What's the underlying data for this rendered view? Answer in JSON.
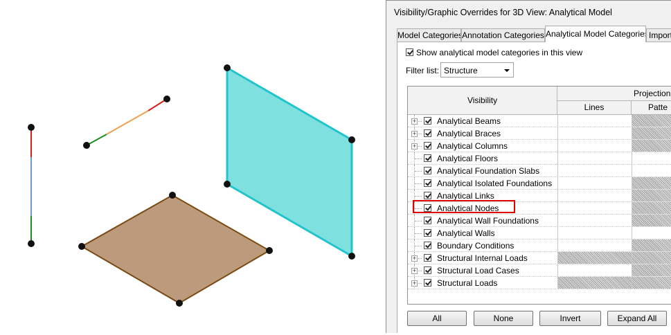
{
  "dialog": {
    "title": "Visibility/Graphic Overrides for 3D View: Analytical Model",
    "tabs": [
      {
        "label": "Model Categories",
        "active": false
      },
      {
        "label": "Annotation Categories",
        "active": false
      },
      {
        "label": "Analytical Model Categories",
        "active": true
      },
      {
        "label": "Import",
        "active": false
      }
    ],
    "show_checkbox": {
      "checked": true,
      "label": "Show analytical model categories in this view"
    },
    "filter": {
      "label": "Filter list:",
      "value": "Structure"
    },
    "table": {
      "header_visibility": "Visibility",
      "header_projection": "Projection",
      "header_lines": "Lines",
      "header_patterns": "Patte",
      "rows": [
        {
          "name": "Analytical Beams",
          "expandable": true,
          "checked": true,
          "lines_hatched": false,
          "patterns_hatched": true
        },
        {
          "name": "Analytical Braces",
          "expandable": true,
          "checked": true,
          "lines_hatched": false,
          "patterns_hatched": true
        },
        {
          "name": "Analytical Columns",
          "expandable": true,
          "checked": true,
          "lines_hatched": false,
          "patterns_hatched": true
        },
        {
          "name": "Analytical Floors",
          "expandable": false,
          "checked": true,
          "lines_hatched": false,
          "patterns_hatched": false
        },
        {
          "name": "Analytical Foundation Slabs",
          "expandable": false,
          "checked": true,
          "lines_hatched": false,
          "patterns_hatched": false
        },
        {
          "name": "Analytical Isolated Foundations",
          "expandable": false,
          "checked": true,
          "lines_hatched": false,
          "patterns_hatched": true
        },
        {
          "name": "Analytical Links",
          "expandable": false,
          "checked": true,
          "lines_hatched": false,
          "patterns_hatched": true
        },
        {
          "name": "Analytical Nodes",
          "expandable": false,
          "checked": true,
          "lines_hatched": false,
          "patterns_hatched": true
        },
        {
          "name": "Analytical Wall Foundations",
          "expandable": false,
          "checked": true,
          "lines_hatched": false,
          "patterns_hatched": true
        },
        {
          "name": "Analytical Walls",
          "expandable": false,
          "checked": true,
          "lines_hatched": false,
          "patterns_hatched": false
        },
        {
          "name": "Boundary Conditions",
          "expandable": false,
          "checked": true,
          "lines_hatched": false,
          "patterns_hatched": true
        },
        {
          "name": "Structural Internal Loads",
          "expandable": true,
          "checked": true,
          "lines_hatched": true,
          "patterns_hatched": true
        },
        {
          "name": "Structural Load Cases",
          "expandable": true,
          "checked": true,
          "lines_hatched": false,
          "patterns_hatched": true
        },
        {
          "name": "Structural Loads",
          "expandable": true,
          "checked": true,
          "lines_hatched": true,
          "patterns_hatched": true
        }
      ],
      "highlighted_row": "Analytical Nodes"
    },
    "buttons": {
      "all": "All",
      "none": "None",
      "invert": "Invert",
      "expand_all": "Expand All"
    }
  },
  "colors": {
    "highlight_border": "#e00000",
    "wall_fill": "#7fe0e0",
    "wall_edge": "#22c4cc",
    "floor_fill": "#bc9a7c",
    "floor_edge": "#7a4a12",
    "column_top": "#d02020",
    "column_mid": "#6c9ad0",
    "column_bottom": "#1f8a1f",
    "beam_start": "#1f8a1f",
    "beam_mid": "#f0a050",
    "beam_end": "#d02020",
    "node": "#111111"
  },
  "icons": {
    "expand": "plus-box-icon",
    "dropdown": "chevron-down-icon",
    "checkbox": "checkmark-icon"
  }
}
